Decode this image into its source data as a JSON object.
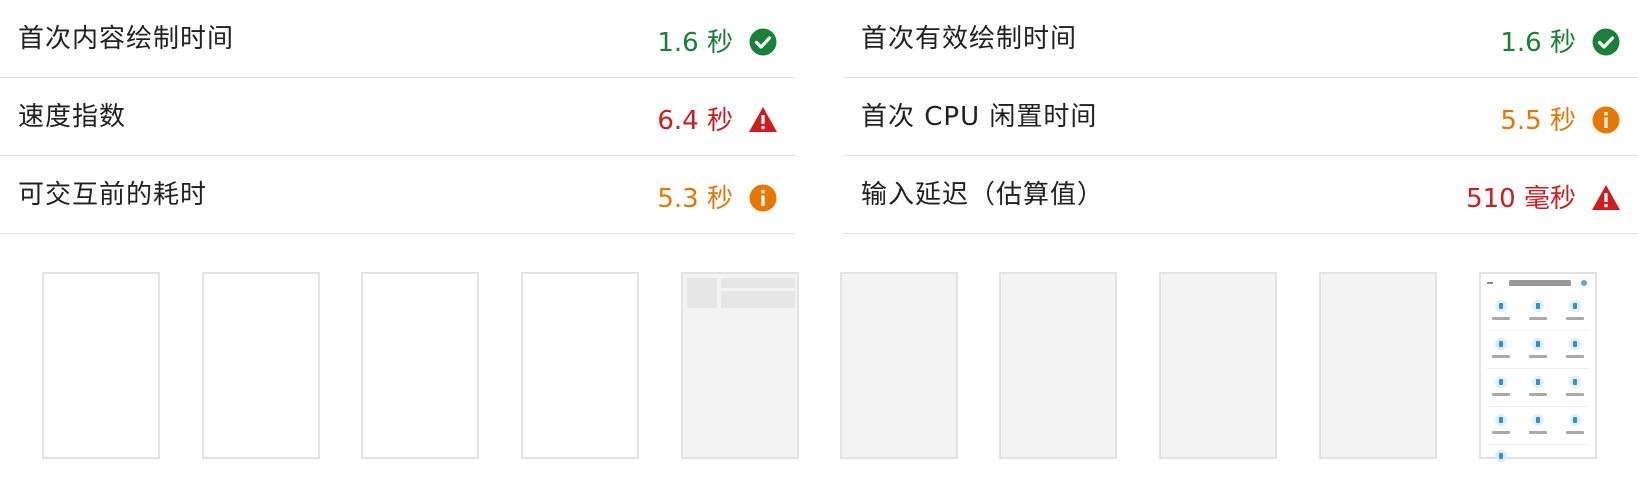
{
  "metrics": {
    "left": [
      {
        "label": "首次内容绘制时间",
        "value": "1.6 秒",
        "status": "pass",
        "icon": "check-circle-icon"
      },
      {
        "label": "速度指数",
        "value": "6.4 秒",
        "status": "fail",
        "icon": "warning-triangle-icon"
      },
      {
        "label": "可交互前的耗时",
        "value": "5.3 秒",
        "status": "average",
        "icon": "info-circle-icon"
      }
    ],
    "right": [
      {
        "label": "首次有效绘制时间",
        "value": "1.6 秒",
        "status": "pass",
        "icon": "check-circle-icon"
      },
      {
        "label": "首次 CPU 闲置时间",
        "value": "5.5 秒",
        "status": "average",
        "icon": "info-circle-icon"
      },
      {
        "label": "输入延迟（估算值）",
        "value": "510 毫秒",
        "status": "fail",
        "icon": "warning-triangle-icon"
      }
    ]
  },
  "colors": {
    "pass": "#188038",
    "average": "#e67700",
    "fail": "#d01c1c",
    "divider": "#e0e0e0"
  },
  "filmstrip": {
    "frame_count": 10,
    "frames": [
      "blank",
      "blank",
      "blank",
      "blank",
      "skeleton",
      "grey",
      "grey",
      "grey",
      "grey",
      "rendered-app-grid"
    ]
  }
}
